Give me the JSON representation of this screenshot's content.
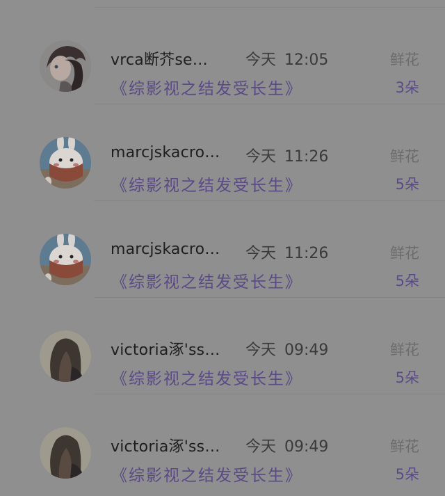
{
  "gift_list": {
    "items": [
      {
        "username": "vrca断芥se…",
        "date_label": "今天",
        "time": "12:05",
        "book_title": "《综影视之结发受长生》",
        "gift_type": "鲜花",
        "gift_count": "3朵",
        "avatar_icon": "girl-portrait-avatar-icon"
      },
      {
        "username": "marcjskacro…",
        "date_label": "今天",
        "time": "11:26",
        "book_title": "《综影视之结发受长生》",
        "gift_type": "鲜花",
        "gift_count": "5朵",
        "avatar_icon": "cartoon-rabbit-avatar-icon"
      },
      {
        "username": "marcjskacro…",
        "date_label": "今天",
        "time": "11:26",
        "book_title": "《综影视之结发受长生》",
        "gift_type": "鲜花",
        "gift_count": "5朵",
        "avatar_icon": "cartoon-rabbit-avatar-icon"
      },
      {
        "username": "victoria涿'ss…",
        "date_label": "今天",
        "time": "09:49",
        "book_title": "《综影视之结发受长生》",
        "gift_type": "鲜花",
        "gift_count": "5朵",
        "avatar_icon": "long-hair-girl-avatar-icon"
      },
      {
        "username": "victoria涿'ss…",
        "date_label": "今天",
        "time": "09:49",
        "book_title": "《综影视之结发受长生》",
        "gift_type": "鲜花",
        "gift_count": "5朵",
        "avatar_icon": "long-hair-girl-avatar-icon"
      }
    ]
  }
}
